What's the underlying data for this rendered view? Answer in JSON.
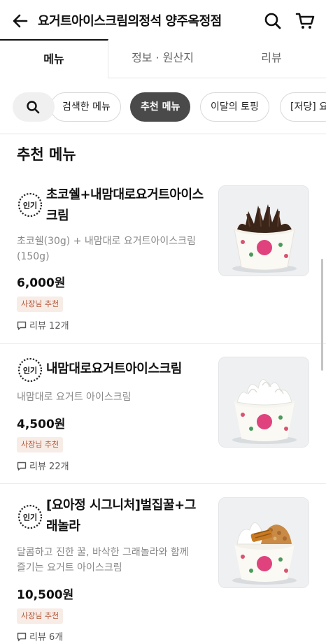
{
  "header": {
    "title": "요거트아이스크림의정석 양주옥정점",
    "back_icon": "arrow-left-icon",
    "search_icon": "search-icon",
    "cart_icon": "cart-icon"
  },
  "tabs": [
    {
      "label": "메뉴",
      "active": true
    },
    {
      "label": "정보 · 원산지",
      "active": false
    },
    {
      "label": "리뷰",
      "active": false
    }
  ],
  "chips": [
    {
      "label": "검색한 메뉴",
      "active": false
    },
    {
      "label": "추천 메뉴",
      "active": true
    },
    {
      "label": "이달의 토핑",
      "active": false
    },
    {
      "label": "[저당] 요",
      "active": false
    }
  ],
  "section": {
    "title": "추천 메뉴"
  },
  "items": [
    {
      "badge": "인기",
      "name": "초코쉘+내맘대로요거트아이스크림",
      "description": "초코쉘(30g) + 내맘대로 요거트아이스크림(150g)",
      "price": "6,000원",
      "tag": "사장님 추천",
      "review": "리뷰 12개"
    },
    {
      "badge": "인기",
      "name": "내맘대로요거트아이스크림",
      "description": "내맘대로 요거트 아이스크림",
      "price": "4,500원",
      "tag": "사장님 추천",
      "review": "리뷰 22개"
    },
    {
      "badge": "인기",
      "name": "[요아정 시그니처]벌집꿀+그래놀라",
      "description": "달콤하고 진한 꿀, 바삭한 그래놀라와 함께 즐기는 요거트 아이스크림",
      "price": "10,500원",
      "tag": "사장님 추천",
      "review": "리뷰 6개"
    }
  ],
  "colors": {
    "active_chip_bg": "#4a4a4a",
    "tag_bg": "#f7ece6",
    "tag_text": "#b2593d",
    "cup_pink": "#e0427d"
  }
}
